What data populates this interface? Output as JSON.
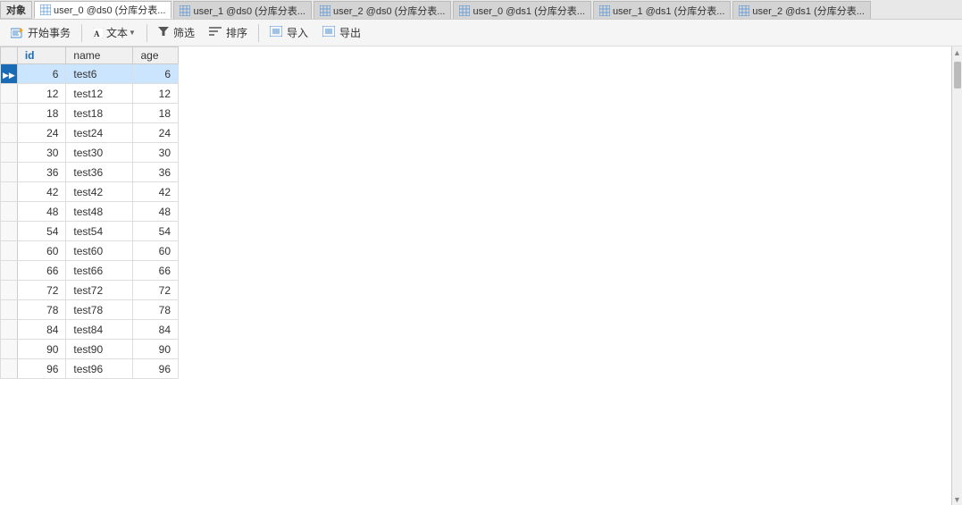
{
  "tabs": [
    {
      "id": "tab0",
      "label": "user_0 @ds0 (分库分表...",
      "active": true
    },
    {
      "id": "tab1",
      "label": "user_1 @ds0 (分库分表...",
      "active": false
    },
    {
      "id": "tab2",
      "label": "user_2 @ds0 (分库分表...",
      "active": false
    },
    {
      "id": "tab3",
      "label": "user_0 @ds1 (分库分表...",
      "active": false
    },
    {
      "id": "tab4",
      "label": "user_1 @ds1 (分库分表...",
      "active": false
    },
    {
      "id": "tab5",
      "label": "user_2 @ds1 (分库分表...",
      "active": false
    }
  ],
  "object_label": "对象",
  "toolbar": {
    "begin_transaction": "开始事务",
    "text": "文本",
    "filter": "筛选",
    "sort": "排序",
    "import": "导入",
    "export": "导出"
  },
  "table": {
    "columns": [
      {
        "id": "id",
        "label": "id"
      },
      {
        "id": "name",
        "label": "name"
      },
      {
        "id": "age",
        "label": "age"
      }
    ],
    "rows": [
      {
        "id": 6,
        "name": "test6",
        "age": 6,
        "active": true
      },
      {
        "id": 12,
        "name": "test12",
        "age": 12,
        "active": false
      },
      {
        "id": 18,
        "name": "test18",
        "age": 18,
        "active": false
      },
      {
        "id": 24,
        "name": "test24",
        "age": 24,
        "active": false
      },
      {
        "id": 30,
        "name": "test30",
        "age": 30,
        "active": false
      },
      {
        "id": 36,
        "name": "test36",
        "age": 36,
        "active": false
      },
      {
        "id": 42,
        "name": "test42",
        "age": 42,
        "active": false
      },
      {
        "id": 48,
        "name": "test48",
        "age": 48,
        "active": false
      },
      {
        "id": 54,
        "name": "test54",
        "age": 54,
        "active": false
      },
      {
        "id": 60,
        "name": "test60",
        "age": 60,
        "active": false
      },
      {
        "id": 66,
        "name": "test66",
        "age": 66,
        "active": false
      },
      {
        "id": 72,
        "name": "test72",
        "age": 72,
        "active": false
      },
      {
        "id": 78,
        "name": "test78",
        "age": 78,
        "active": false
      },
      {
        "id": 84,
        "name": "test84",
        "age": 84,
        "active": false
      },
      {
        "id": 90,
        "name": "test90",
        "age": 90,
        "active": false
      },
      {
        "id": 96,
        "name": "test96",
        "age": 96,
        "active": false
      }
    ]
  }
}
